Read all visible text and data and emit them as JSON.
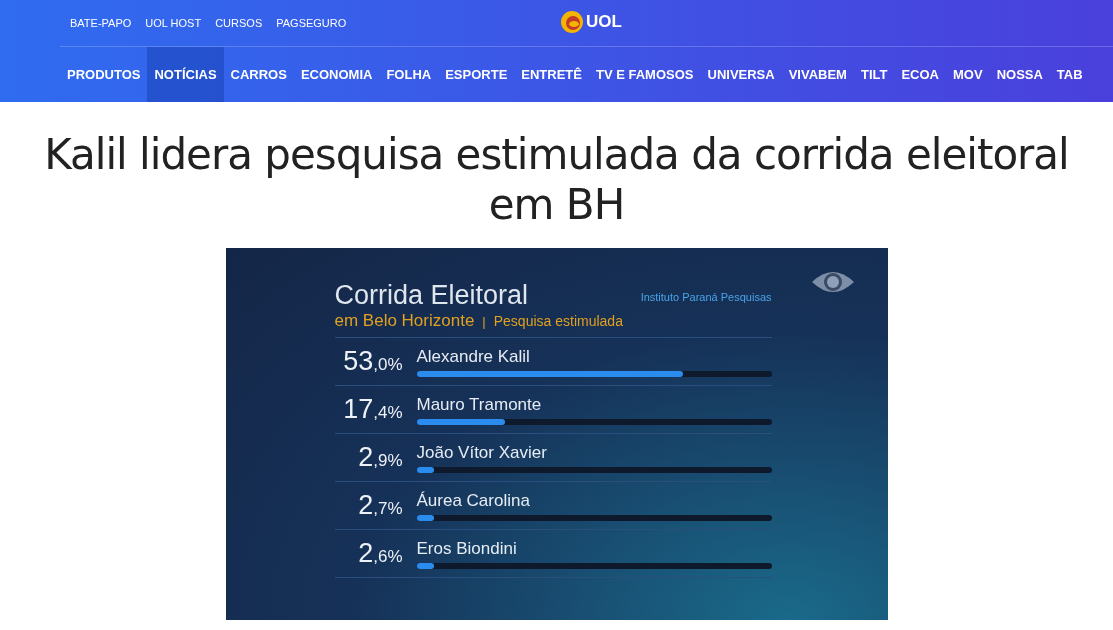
{
  "top_links": [
    "BATE-PAPO",
    "UOL HOST",
    "CURSOS",
    "PAGSEGURO"
  ],
  "logo": {
    "text": "UOL"
  },
  "nav": [
    {
      "label": "PRODUTOS",
      "selected": false
    },
    {
      "label": "NOTÍCIAS",
      "selected": true
    },
    {
      "label": "CARROS",
      "selected": false
    },
    {
      "label": "ECONOMIA",
      "selected": false
    },
    {
      "label": "FOLHA",
      "selected": false
    },
    {
      "label": "ESPORTE",
      "selected": false
    },
    {
      "label": "ENTRETÊ",
      "selected": false
    },
    {
      "label": "TV E FAMOSOS",
      "selected": false
    },
    {
      "label": "UNIVERSA",
      "selected": false
    },
    {
      "label": "VIVABEM",
      "selected": false
    },
    {
      "label": "TILT",
      "selected": false
    },
    {
      "label": "ECOA",
      "selected": false
    },
    {
      "label": "MOV",
      "selected": false
    },
    {
      "label": "NOSSA",
      "selected": false
    },
    {
      "label": "TAB",
      "selected": false
    }
  ],
  "headline": "Kalil lidera pesquisa estimulada da corrida eleitoral em BH",
  "graphic": {
    "title": "Corrida Eleitoral",
    "subtitle": "em Belo Horizonte",
    "separator": "|",
    "poll_type": "Pesquisa estimulada",
    "source": "Instituto Paraná Pesquisas",
    "candidates": [
      {
        "whole": "53",
        "decimal": ",0%",
        "name": "Alexandre Kalil",
        "level": 0.75
      },
      {
        "whole": "17",
        "decimal": ",4%",
        "name": "Mauro Tramonte",
        "level": 0.25
      },
      {
        "whole": "2",
        "decimal": ",9%",
        "name": "João Vítor Xavier",
        "level": 0.05
      },
      {
        "whole": "2",
        "decimal": ",7%",
        "name": "Áurea Carolina",
        "level": 0.05
      },
      {
        "whole": "2",
        "decimal": ",6%",
        "name": "Eros Biondini",
        "level": 0.05
      }
    ]
  }
}
